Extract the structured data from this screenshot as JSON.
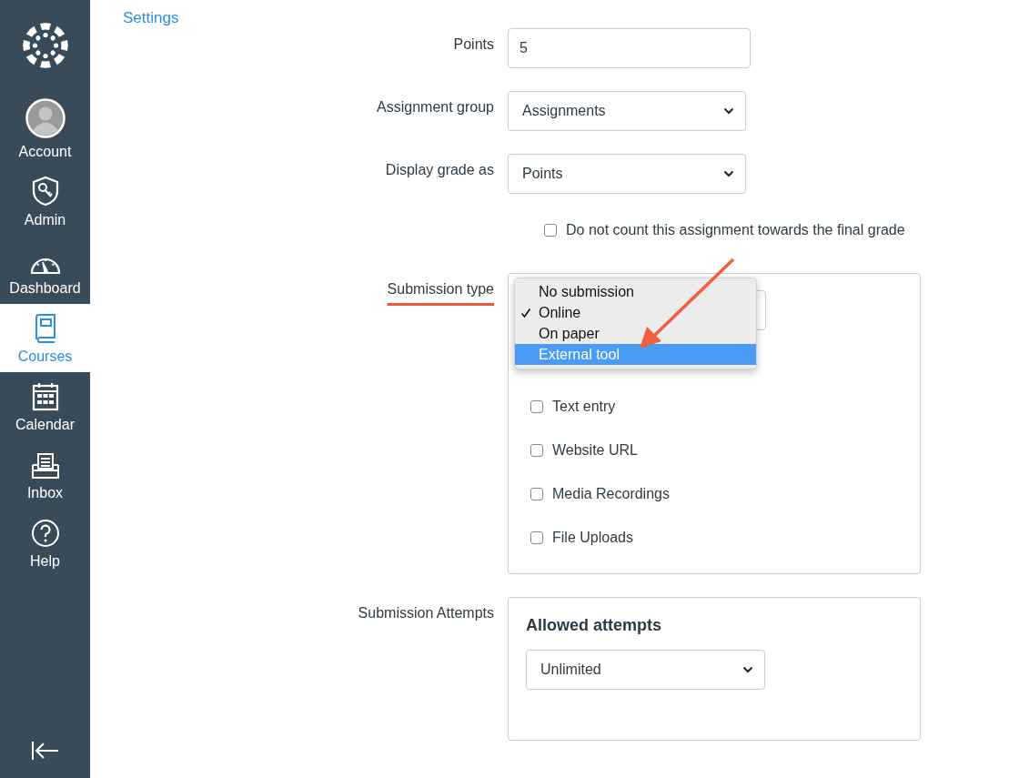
{
  "sidebar": {
    "items": [
      {
        "label": "Account",
        "selected": false
      },
      {
        "label": "Admin",
        "selected": false
      },
      {
        "label": "Dashboard",
        "selected": false
      },
      {
        "label": "Courses",
        "selected": true
      },
      {
        "label": "Calendar",
        "selected": false
      },
      {
        "label": "Inbox",
        "selected": false
      },
      {
        "label": "Help",
        "selected": false
      }
    ]
  },
  "settings_link": "Settings",
  "form": {
    "points": {
      "label": "Points",
      "value": "5"
    },
    "assignment_group": {
      "label": "Assignment group",
      "value": "Assignments"
    },
    "display_grade_as": {
      "label": "Display grade as",
      "value": "Points"
    },
    "exclude_checkbox": {
      "label": "Do not count this assignment towards the final grade",
      "checked": false
    },
    "submission_type": {
      "label": "Submission type",
      "options": [
        {
          "label": "No submission",
          "checked": false,
          "selected": false
        },
        {
          "label": "Online",
          "checked": true,
          "selected": false
        },
        {
          "label": "On paper",
          "checked": false,
          "selected": false
        },
        {
          "label": "External tool",
          "checked": false,
          "selected": true
        }
      ],
      "entry_options": [
        {
          "label": "Text entry",
          "checked": false
        },
        {
          "label": "Website URL",
          "checked": false
        },
        {
          "label": "Media Recordings",
          "checked": false
        },
        {
          "label": "File Uploads",
          "checked": false
        }
      ]
    },
    "submission_attempts": {
      "label": "Submission Attempts",
      "heading": "Allowed attempts",
      "value": "Unlimited"
    }
  }
}
